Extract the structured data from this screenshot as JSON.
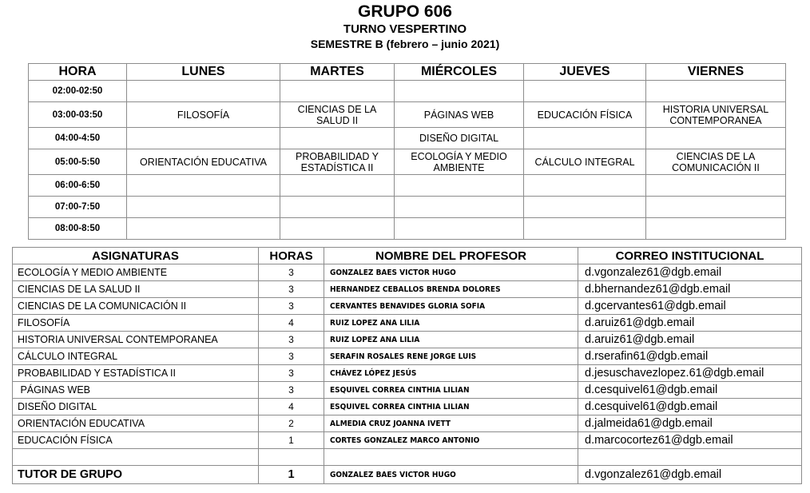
{
  "header": {
    "title": "GRUPO 606",
    "shift": "TURNO VESPERTINO",
    "semester": "SEMESTRE B (febrero – junio 2021)"
  },
  "schedule": {
    "columns": [
      "HORA",
      "LUNES",
      "MARTES",
      "MIÉRCOLES",
      "JUEVES",
      "VIERNES"
    ],
    "rows": [
      {
        "hour": "02:00-02:50",
        "cells": [
          "",
          "",
          "",
          "",
          ""
        ]
      },
      {
        "hour": "03:00-03:50",
        "cells": [
          "FILOSOFÍA",
          "CIENCIAS DE LA SALUD II",
          "PÁGINAS WEB",
          "EDUCACIÓN FÍSICA",
          "HISTORIA UNIVERSAL CONTEMPORANEA"
        ]
      },
      {
        "hour": "04:00-4:50",
        "cells": [
          "",
          "",
          "DISEÑO DIGITAL",
          "",
          ""
        ]
      },
      {
        "hour": "05:00-5:50",
        "cells": [
          "ORIENTACIÓN EDUCATIVA",
          "PROBABILIDAD Y ESTADÍSTICA II",
          "ECOLOGÍA Y MEDIO AMBIENTE",
          "CÁLCULO INTEGRAL",
          "CIENCIAS DE LA COMUNICACIÓN II"
        ]
      },
      {
        "hour": "06:00-6:50",
        "cells": [
          "",
          "",
          "",
          "",
          ""
        ]
      },
      {
        "hour": "07:00-7:50",
        "cells": [
          "",
          "",
          "",
          "",
          ""
        ]
      },
      {
        "hour": "08:00-8:50",
        "cells": [
          "",
          "",
          "",
          "",
          ""
        ]
      }
    ]
  },
  "subjects": {
    "columns": [
      "ASIGNATURAS",
      "HORAS",
      "NOMBRE DEL PROFESOR",
      "CORREO INSTITUCIONAL"
    ],
    "rows": [
      {
        "subject": "ECOLOGÍA Y MEDIO AMBIENTE",
        "hours": "3",
        "teacher": "GONZALEZ BAES VICTOR HUGO",
        "email": "d.vgonzalez61@dgb.email"
      },
      {
        "subject": "CIENCIAS DE LA SALUD II",
        "hours": "3",
        "teacher": "HERNANDEZ CEBALLOS BRENDA DOLORES",
        "email": "d.bhernandez61@dgb.email"
      },
      {
        "subject": "CIENCIAS DE LA COMUNICACIÓN II",
        "hours": "3",
        "teacher": "CERVANTES BENAVIDES GLORIA SOFIA",
        "email": "d.gcervantes61@dgb.email"
      },
      {
        "subject": "FILOSOFÍA",
        "hours": "4",
        "teacher": "RUIZ LOPEZ ANA LILIA",
        "email": "d.aruiz61@dgb.email"
      },
      {
        "subject": "HISTORIA UNIVERSAL CONTEMPORANEA",
        "hours": "3",
        "teacher": "RUIZ LOPEZ ANA LILIA",
        "email": "d.aruiz61@dgb.email"
      },
      {
        "subject": "CÁLCULO INTEGRAL",
        "hours": "3",
        "teacher": "SERAFIN ROSALES RENE JORGE LUIS",
        "email": "d.rserafin61@dgb.email"
      },
      {
        "subject": "PROBABILIDAD Y ESTADÍSTICA II",
        "hours": "3",
        "teacher": "CHÁVEZ LÓPEZ JESÚS",
        "email": "d.jesuschavezlopez.61@dgb.email"
      },
      {
        "subject": " PÁGINAS WEB",
        "hours": "3",
        "teacher": "ESQUIVEL CORREA CINTHIA LILIAN",
        "email": "d.cesquivel61@dgb.email"
      },
      {
        "subject": "DISEÑO DIGITAL",
        "hours": "4",
        "teacher": "ESQUIVEL CORREA CINTHIA LILIAN",
        "email": "d.cesquivel61@dgb.email"
      },
      {
        "subject": "ORIENTACIÓN EDUCATIVA",
        "hours": "2",
        "teacher": "ALMEDIA CRUZ JOANNA IVETT",
        "email": "d.jalmeida61@dgb.email"
      },
      {
        "subject": "EDUCACIÓN FÍSICA",
        "hours": "1",
        "teacher": "CORTES GONZALEZ MARCO ANTONIO",
        "email": "d.marcocortez61@dgb.email"
      }
    ],
    "tutor": {
      "label": "TUTOR DE GRUPO",
      "hours": "1",
      "teacher": "GONZALEZ BAES VICTOR HUGO",
      "email": "d.vgonzalez61@dgb.email"
    }
  }
}
